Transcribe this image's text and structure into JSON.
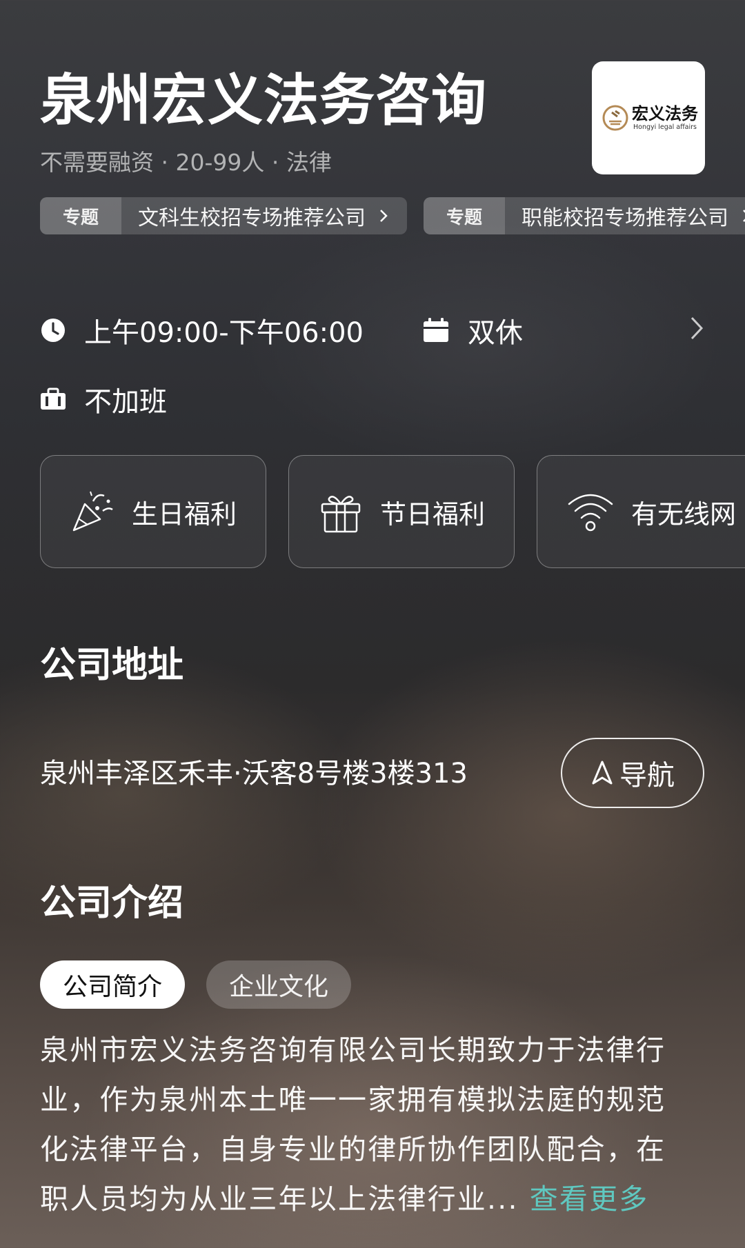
{
  "company": {
    "name": "泉州宏义法务咨询",
    "meta": "不需要融资 · 20-99人 · 法律",
    "logo_cn": "宏义法务",
    "logo_en": "Hongyi legal affairs"
  },
  "topics": [
    {
      "tag": "专题",
      "text": "文科生校招专场推荐公司"
    },
    {
      "tag": "专题",
      "text": "职能校招专场推荐公司"
    }
  ],
  "work_info": {
    "hours": "上午09:00-下午06:00",
    "rest": "双休",
    "overtime": "不加班"
  },
  "benefits": [
    {
      "icon": "party-popper-icon",
      "label": "生日福利"
    },
    {
      "icon": "gift-icon",
      "label": "节日福利"
    },
    {
      "icon": "wifi-icon",
      "label": "有无线网"
    }
  ],
  "address_section": {
    "title": "公司地址",
    "address": "泉州丰泽区禾丰·沃客8号楼3楼313",
    "nav_label": "导航"
  },
  "intro_section": {
    "title": "公司介绍",
    "tabs": [
      "公司简介",
      "企业文化"
    ],
    "active_tab": "公司简介",
    "lines": [
      "泉州市宏义法务咨询有限公司长期致力于法律行",
      "业，作为泉州本土唯一一家拥有模拟法庭的规范",
      "化法律平台，自身专业的律所协作团队配合，在",
      "职人员均为从业三年以上法律行业..."
    ],
    "more_label": "查看更多"
  },
  "colors": {
    "accent_teal": "#5fc8c0",
    "text_primary": "#ffffff"
  }
}
